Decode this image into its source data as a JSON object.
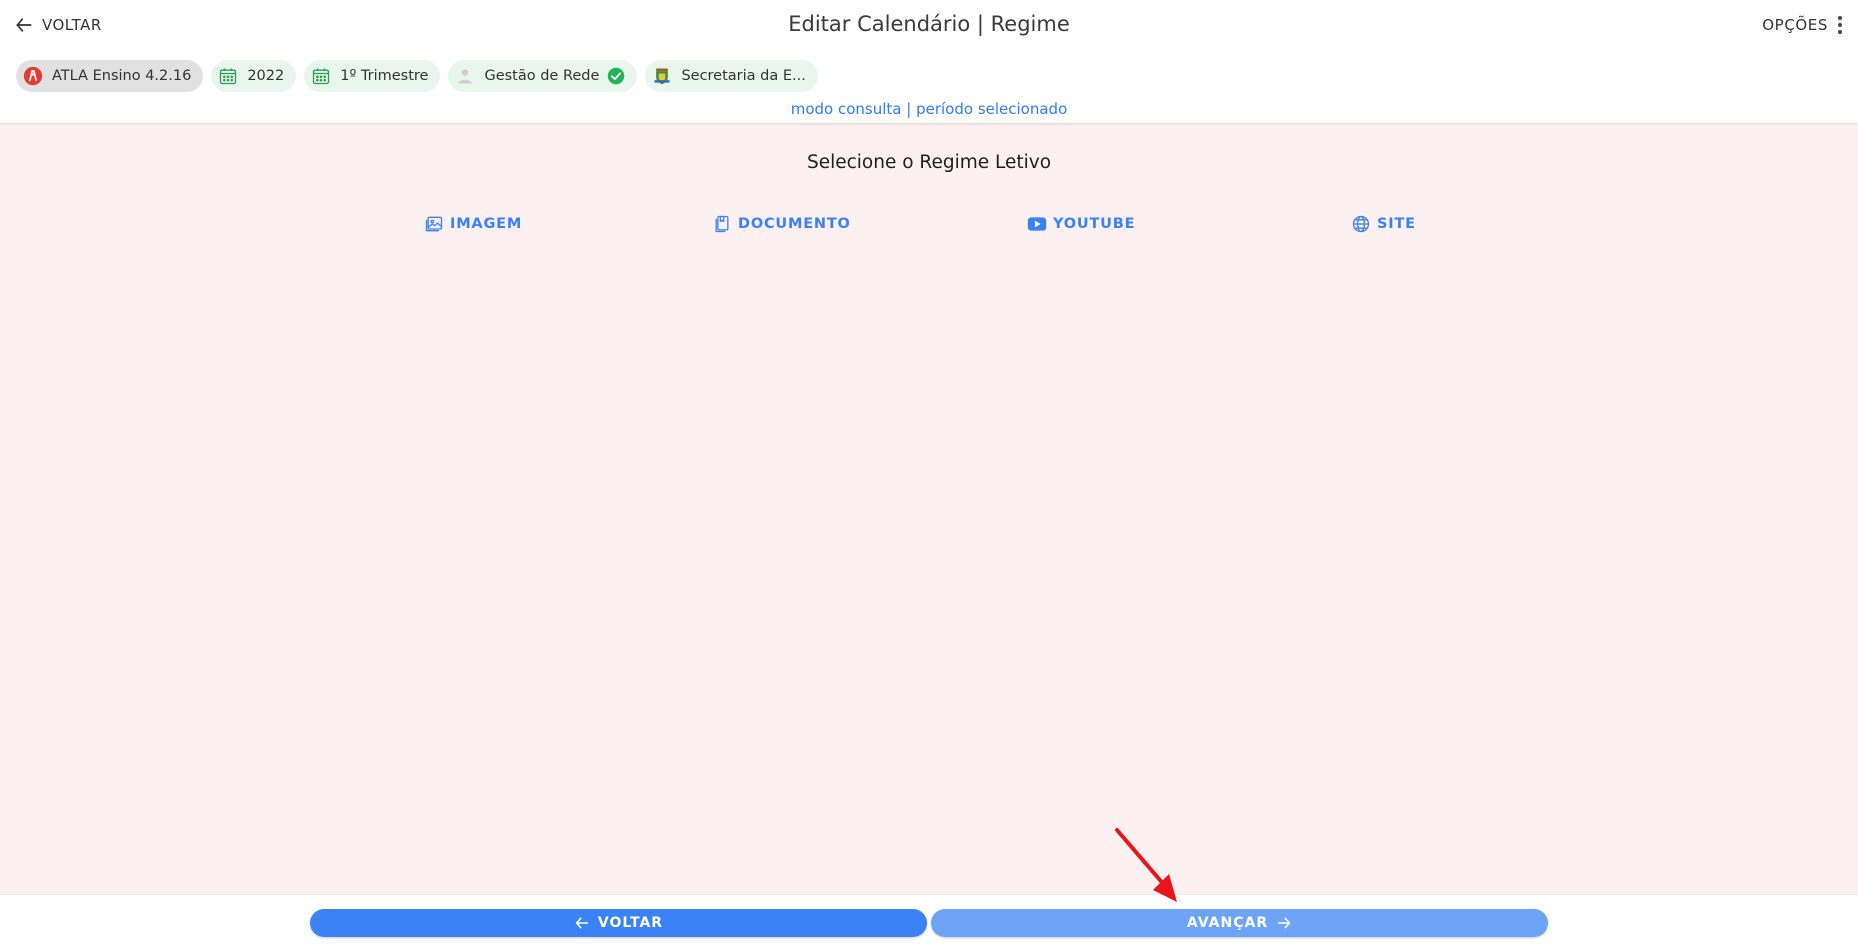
{
  "header": {
    "back_label": "VOLTAR",
    "title": "Editar Calendário | Regime",
    "options_label": "OPÇÕES"
  },
  "chips": [
    {
      "label": "ATLA Ensino 4.2.16",
      "icon": "atla-logo-icon"
    },
    {
      "label": "2022",
      "icon": "calendar-icon"
    },
    {
      "label": "1º Trimestre",
      "icon": "calendar-icon"
    },
    {
      "label": "Gestão de Rede",
      "icon": "user-icon",
      "status_icon": "check-circle-icon"
    },
    {
      "label": "Secretaria da E...",
      "icon": "municipal-crest-icon"
    }
  ],
  "mode_text": "modo consulta | período selecionado",
  "main": {
    "title": "Selecione o Regime Letivo",
    "media_buttons": [
      {
        "label": "IMAGEM",
        "icon": "image-icon"
      },
      {
        "label": "DOCUMENTO",
        "icon": "document-icon"
      },
      {
        "label": "YOUTUBE",
        "icon": "youtube-icon"
      },
      {
        "label": "SITE",
        "icon": "globe-icon"
      }
    ]
  },
  "footer": {
    "back_label": "VOLTAR",
    "next_label": "AVANÇAR"
  },
  "colors": {
    "accent": "#3b82f6",
    "accent_light": "#6ea4f8",
    "content_bg": "#fcf0f0",
    "chip_bg": "#e9f6ee",
    "annotation_arrow": "#e8161b"
  }
}
